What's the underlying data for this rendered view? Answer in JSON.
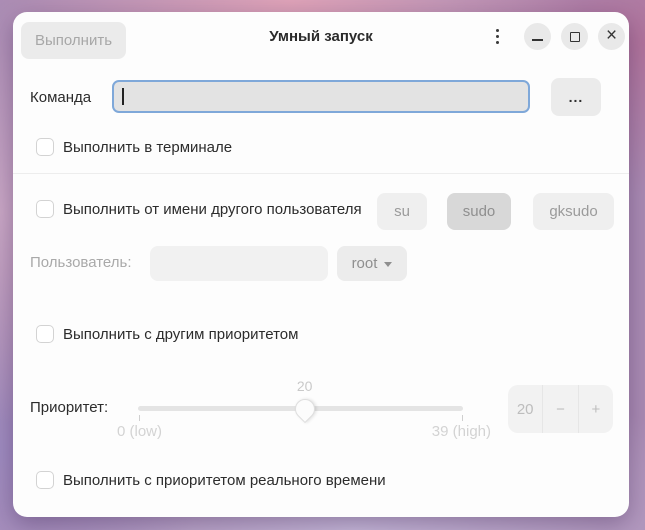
{
  "window": {
    "title": "Умный запуск",
    "run_button_label": "Выполнить"
  },
  "icons": {
    "close": "×"
  },
  "command": {
    "label": "Команда",
    "value": "",
    "placeholder": "",
    "browse_label": "..."
  },
  "options": {
    "terminal_label": "Выполнить в терминале",
    "other_user_label": "Выполнить от имени другого пользователя",
    "custom_priority_label": "Выполнить с другим приоритетом",
    "realtime_label": "Выполнить с приоритетом реального времени"
  },
  "sudo": {
    "options": [
      "su",
      "sudo",
      "gksudo"
    ],
    "selected": "sudo"
  },
  "user": {
    "label": "Пользователь:",
    "value": "",
    "placeholder": "",
    "selected_option": "root"
  },
  "priority": {
    "label": "Приоритет:",
    "value": 20,
    "min": 0,
    "max": 39,
    "min_label": "0 (low)",
    "max_label": "39 (high)"
  },
  "spinner": {
    "value": "20",
    "minus": "−",
    "plus": "+"
  },
  "colors": {
    "focus_border": "#7fa8d9",
    "selected_sudo_bg": "#d8d8d8",
    "window_bg": "#fdfdfd"
  }
}
